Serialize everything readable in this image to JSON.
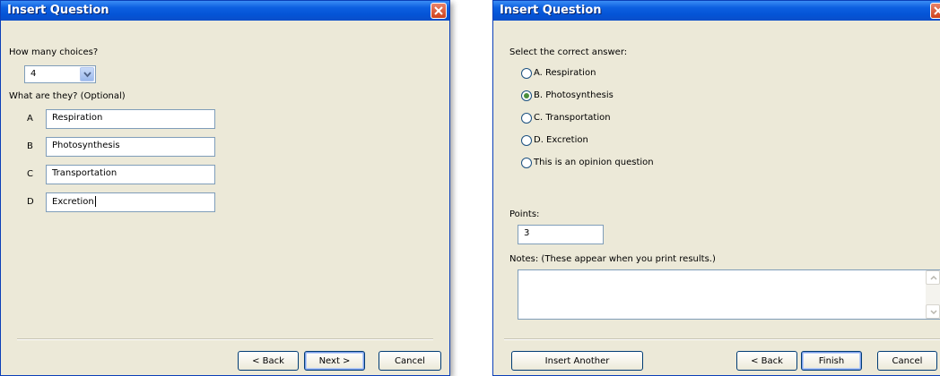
{
  "dialog1": {
    "title": "Insert Question",
    "choices_label": "How many choices?",
    "choices_value": "4",
    "options_label": "What are they? (Optional)",
    "options": [
      {
        "letter": "A",
        "value": "Respiration"
      },
      {
        "letter": "B",
        "value": "Photosynthesis"
      },
      {
        "letter": "C",
        "value": "Transportation"
      },
      {
        "letter": "D",
        "value": "Excretion"
      }
    ],
    "back_label": "< Back",
    "next_label": "Next >",
    "cancel_label": "Cancel"
  },
  "dialog2": {
    "title": "Insert Question",
    "answer_label": "Select the correct answer:",
    "answers": [
      {
        "label": "A.  Respiration",
        "selected": false
      },
      {
        "label": "B.  Photosynthesis",
        "selected": true
      },
      {
        "label": "C.  Transportation",
        "selected": false
      },
      {
        "label": "D.  Excretion",
        "selected": false
      },
      {
        "label": "This is an opinion question",
        "selected": false
      }
    ],
    "points_label": "Points:",
    "points_value": "3",
    "notes_label": "Notes: (These appear when you print results.)",
    "notes_value": "",
    "insert_another_label": "Insert Another",
    "back_label": "< Back",
    "finish_label": "Finish",
    "cancel_label": "Cancel"
  },
  "colors": {
    "titlebar": "#0454d6",
    "dialog_bg": "#ece9d8",
    "close_button": "#d0421c",
    "input_border": "#7f9db9"
  }
}
